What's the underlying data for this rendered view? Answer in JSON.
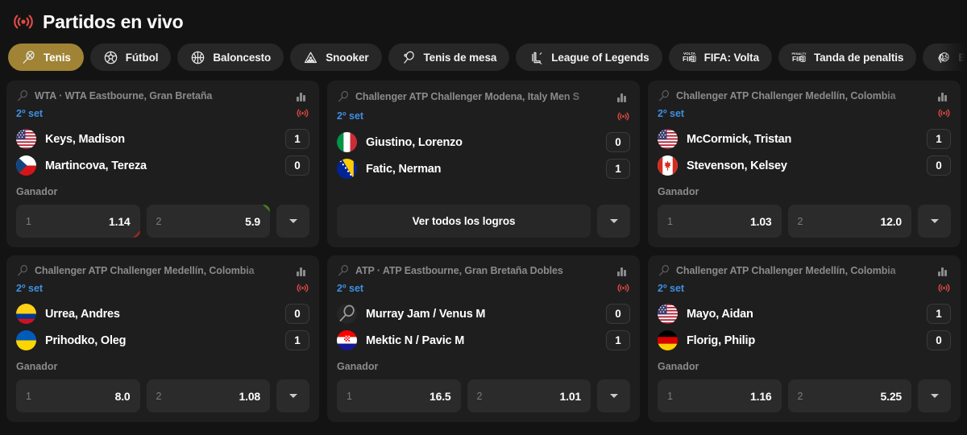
{
  "header": {
    "title": "Partidos en vivo",
    "icon": "live-broadcast-icon"
  },
  "tabs": [
    {
      "label": "Tenis",
      "icon": "tennis-racket-icon",
      "active": true
    },
    {
      "label": "Fútbol",
      "icon": "soccer-ball-icon",
      "active": false
    },
    {
      "label": "Baloncesto",
      "icon": "basketball-icon",
      "active": false
    },
    {
      "label": "Snooker",
      "icon": "snooker-rack-icon",
      "active": false
    },
    {
      "label": "Tenis de mesa",
      "icon": "table-tennis-icon",
      "active": false
    },
    {
      "label": "League of Legends",
      "icon": "lol-icon",
      "active": false
    },
    {
      "label": "FIFA: Volta",
      "icon": "fifa-volta-icon",
      "active": false
    },
    {
      "label": "Tanda de penaltis",
      "icon": "fifa-penalty-icon",
      "active": false
    },
    {
      "label": "Balonmano",
      "icon": "handball-icon",
      "active": false
    }
  ],
  "labels": {
    "market_title": "Ganador",
    "stats_icon": "bar-chart-icon",
    "live_icon": "live-broadcast-icon",
    "more_icon": "chevron-down-icon"
  },
  "cards": [
    {
      "tournament": "WTA · WTA Eastbourne, Gran Bretaña",
      "set": "2º set",
      "players": [
        {
          "name": "Keys, Madison",
          "flag": "us",
          "score": "1"
        },
        {
          "name": "Martincova, Tereza",
          "flag": "cz",
          "score": "0"
        }
      ],
      "market": "Ganador",
      "odds": [
        {
          "key": "1",
          "value": "1.14",
          "trend": "down"
        },
        {
          "key": "2",
          "value": "5.9",
          "trend": "up"
        }
      ],
      "cta": null
    },
    {
      "tournament": "Challenger ATP Challenger Modena, Italy Men S",
      "set": "2º set",
      "players": [
        {
          "name": "Giustino, Lorenzo",
          "flag": "it",
          "score": "0"
        },
        {
          "name": "Fatic, Nerman",
          "flag": "ba",
          "score": "1"
        }
      ],
      "market": null,
      "odds": [],
      "cta": "Ver todos los logros"
    },
    {
      "tournament": "Challenger ATP Challenger Medellín, Colombia",
      "set": "2º set",
      "players": [
        {
          "name": "McCormick, Tristan",
          "flag": "us",
          "score": "1"
        },
        {
          "name": "Stevenson, Kelsey",
          "flag": "ca",
          "score": "0"
        }
      ],
      "market": "Ganador",
      "odds": [
        {
          "key": "1",
          "value": "1.03",
          "trend": "none"
        },
        {
          "key": "2",
          "value": "12.0",
          "trend": "none"
        }
      ],
      "cta": null
    },
    {
      "tournament": "Challenger ATP Challenger Medellín, Colombia",
      "set": "2º set",
      "players": [
        {
          "name": "Urrea, Andres",
          "flag": "co",
          "score": "0"
        },
        {
          "name": "Prihodko, Oleg",
          "flag": "ua",
          "score": "1"
        }
      ],
      "market": "Ganador",
      "odds": [
        {
          "key": "1",
          "value": "8.0",
          "trend": "none"
        },
        {
          "key": "2",
          "value": "1.08",
          "trend": "none"
        }
      ],
      "cta": null
    },
    {
      "tournament": "ATP · ATP Eastbourne, Gran Bretaña Dobles",
      "set": "2º set",
      "players": [
        {
          "name": "Murray Jam / Venus M",
          "flag": "none",
          "score": "0"
        },
        {
          "name": "Mektic N / Pavic M",
          "flag": "hr",
          "score": "1"
        }
      ],
      "market": "Ganador",
      "odds": [
        {
          "key": "1",
          "value": "16.5",
          "trend": "none"
        },
        {
          "key": "2",
          "value": "1.01",
          "trend": "none"
        }
      ],
      "cta": null
    },
    {
      "tournament": "Challenger ATP Challenger Medellín, Colombia",
      "set": "2º set",
      "players": [
        {
          "name": "Mayo, Aidan",
          "flag": "us",
          "score": "1"
        },
        {
          "name": "Florig, Philip",
          "flag": "de",
          "score": "0"
        }
      ],
      "market": "Ganador",
      "odds": [
        {
          "key": "1",
          "value": "1.16",
          "trend": "none"
        },
        {
          "key": "2",
          "value": "5.25",
          "trend": "none"
        }
      ],
      "cta": null
    }
  ],
  "colors": {
    "page_bg": "#131313",
    "card_bg": "#1e1e1e",
    "accent_active_tab": "#a08334",
    "live_red": "#e04b43",
    "set_blue": "#3f8fe0",
    "muted_text": "#8b8b8b",
    "odds_up_green": "#4a7a21",
    "odds_down_red": "#8f2a22"
  }
}
